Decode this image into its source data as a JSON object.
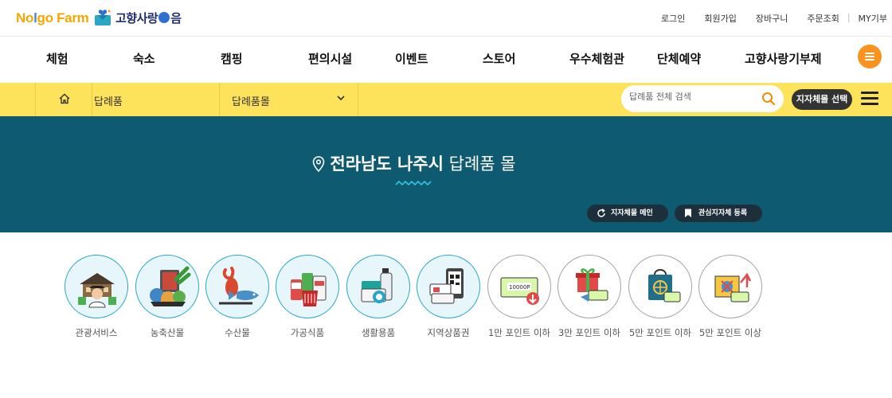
{
  "brand": {
    "logo_main": [
      "No",
      "l",
      "go Farm"
    ],
    "logo_partner": "고향사랑",
    "logo_partner_suffix": "음"
  },
  "util_links": [
    "로그인",
    "회원가입",
    "장바구니",
    "주문조회",
    "MY기부"
  ],
  "main_nav": [
    "체험",
    "숙소",
    "캠핑",
    "편의시설",
    "이벤트",
    "스토어",
    "우수체험관",
    "단체예약",
    "고향사랑기부제"
  ],
  "toolbar": {
    "breadcrumb": "답례품",
    "select_value": "답례품몰",
    "search_placeholder": "답례품 전체 검색",
    "select_region_button": "지자체몰 선택"
  },
  "hero": {
    "region": "전라남도 나주시",
    "mall": "답례품 몰",
    "btn_main": "지자체몰 메인",
    "btn_fav": "관심지자체 등록"
  },
  "categories": [
    {
      "label": "관광서비스",
      "icon": "tourism-icon"
    },
    {
      "label": "농축산물",
      "icon": "agriculture-icon"
    },
    {
      "label": "수산물",
      "icon": "seafood-icon"
    },
    {
      "label": "가공식품",
      "icon": "processed-food-icon"
    },
    {
      "label": "생활용품",
      "icon": "household-icon"
    },
    {
      "label": "지역상품권",
      "icon": "voucher-icon"
    },
    {
      "label": "1만 포인트 이하",
      "icon": "points-10k-icon"
    },
    {
      "label": "3만 포인트 이하",
      "icon": "gift-30k-icon"
    },
    {
      "label": "5만 포인트 이하",
      "icon": "bag-50k-icon"
    },
    {
      "label": "5만 포인트 이상",
      "icon": "giftbox-50k-plus-icon"
    }
  ],
  "colors": {
    "brand_orange": "#f7a600",
    "yellow_bar": "#fde35b",
    "hero_bg": "#0e5a70",
    "accent_blue_circle": "#e7f6fb"
  }
}
